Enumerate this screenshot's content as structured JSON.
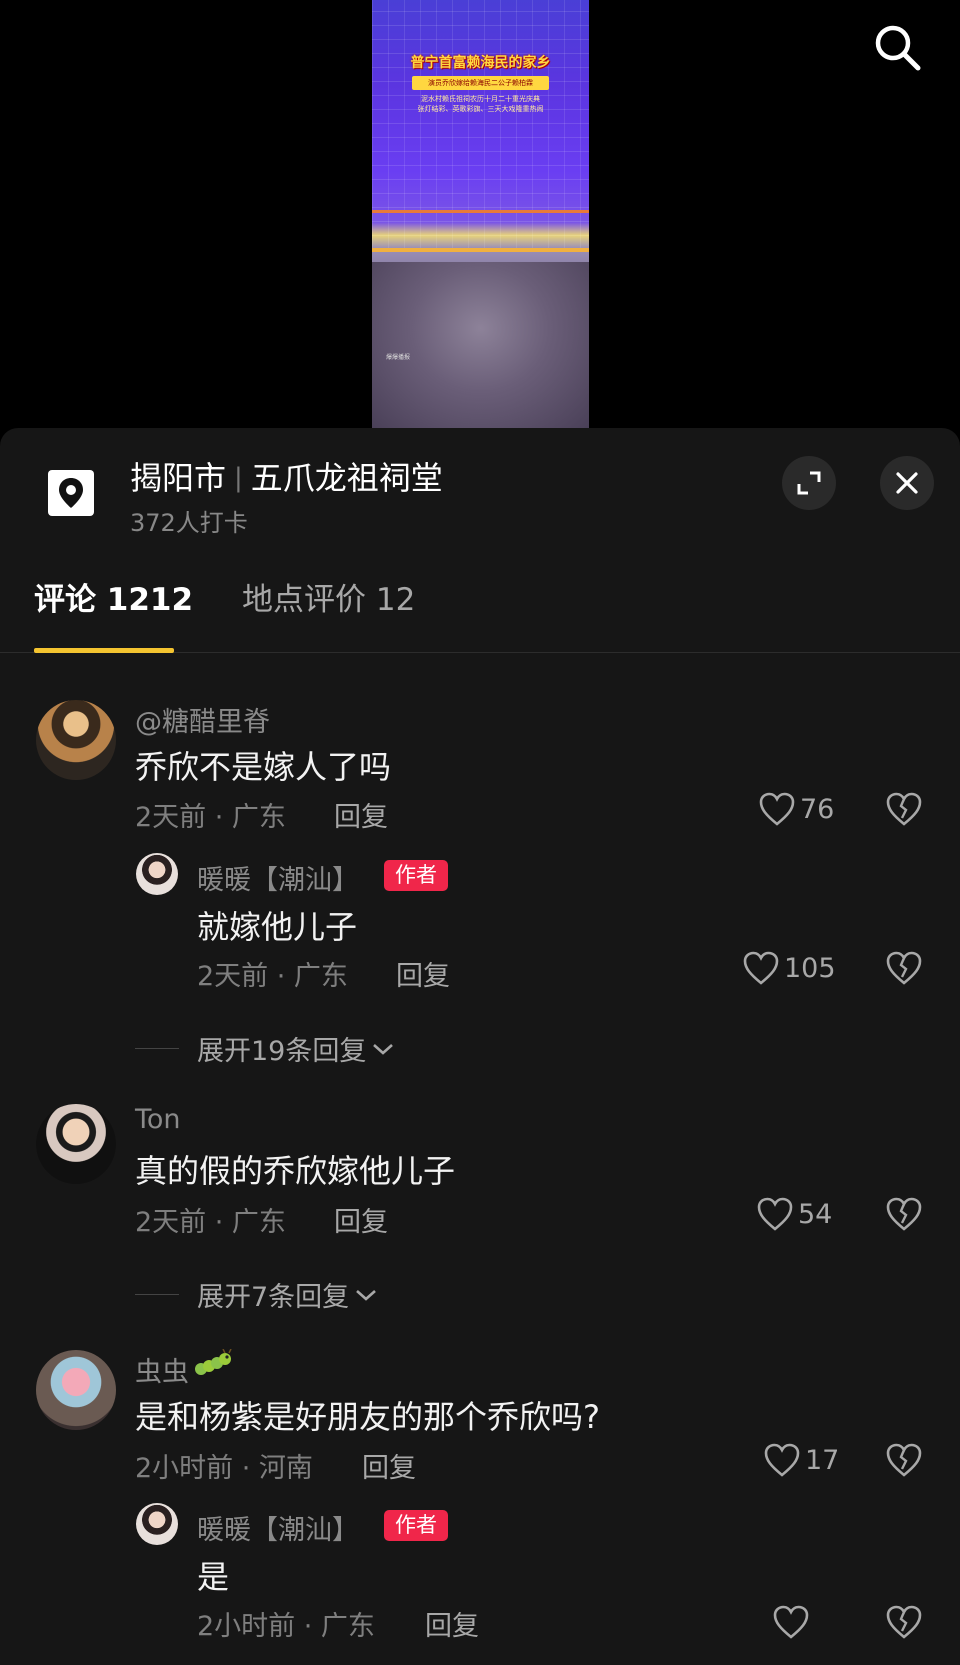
{
  "video": {
    "title": "普宁首富赖海民的家乡",
    "subtitle": "演员乔欣嫁给赖海民二公子赖柏霖",
    "line1": "泥水村赖氏祖祠农历十月二十重光庆典",
    "line2": "张灯结彩、英歌彩旗、三天大戏隆重热闹",
    "watermark": "爆爆播报"
  },
  "location": {
    "city": "揭阳市",
    "separator": "|",
    "place": "五爪龙祖祠堂",
    "checkins": "372人打卡"
  },
  "tabs": {
    "comments": "评论 1212",
    "reviews": "地点评价 12"
  },
  "comments": [
    {
      "user": "@糖醋里脊",
      "text": "乔欣不是嫁人了吗",
      "time": "2天前 · 广东",
      "reply": "回复",
      "likes": "76"
    },
    {
      "user": "Ton",
      "text": "真的假的乔欣嫁他儿子",
      "time": "2天前 · 广东",
      "reply": "回复",
      "likes": "54"
    },
    {
      "user": "虫虫",
      "text": "是和杨紫是好朋友的那个乔欣吗?",
      "time": "2小时前 · 河南",
      "reply": "回复",
      "likes": "17"
    }
  ],
  "replies": [
    {
      "user": "暖暖【潮汕】",
      "badge": "作者",
      "text": "就嫁他儿子",
      "time": "2天前 · 广东",
      "reply": "回复",
      "likes": "105"
    },
    {
      "user": "暖暖【潮汕】",
      "badge": "作者",
      "text": "是",
      "time": "2小时前 · 广东",
      "reply": "回复"
    }
  ],
  "expand": {
    "first": "展开19条回复",
    "second": "展开7条回复"
  },
  "colors": {
    "accent_underline": "#f4c430",
    "author_badge": "#f0264a",
    "sheet_bg": "#161616"
  }
}
